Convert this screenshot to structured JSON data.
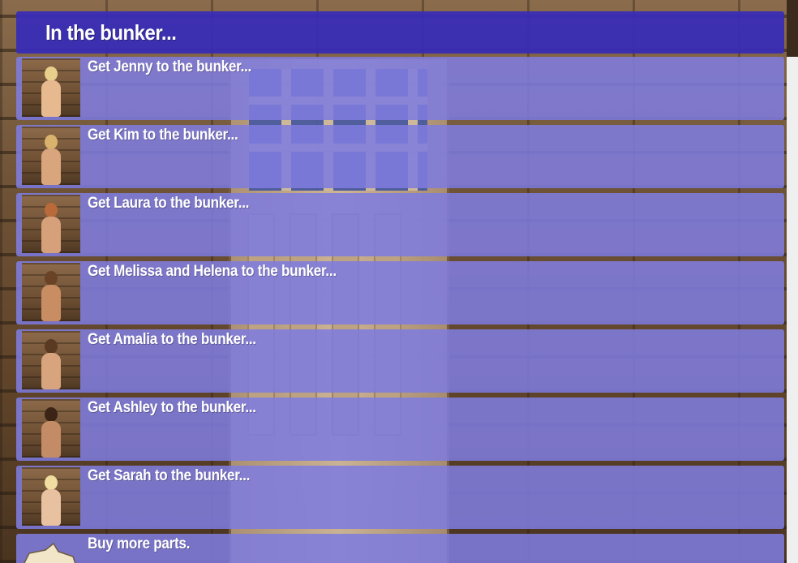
{
  "header": {
    "title": "In the bunker..."
  },
  "items": [
    {
      "label": "Get Jenny to the bunker...",
      "thumb": "jenny-portrait",
      "hair": "#e8cf8c",
      "skin": "#e6b98f"
    },
    {
      "label": "Get Kim to the bunker...",
      "thumb": "kim-portrait",
      "hair": "#d9b36e",
      "skin": "#d8a57c"
    },
    {
      "label": "Get Laura to the bunker...",
      "thumb": "laura-portrait",
      "hair": "#b96a3a",
      "skin": "#d6a07a"
    },
    {
      "label": "Get Melissa and Helena to the bunker...",
      "thumb": "melissa-helena-portrait",
      "hair": "#6a4326",
      "skin": "#c98d64"
    },
    {
      "label": "Get Amalia to the bunker...",
      "thumb": "amalia-portrait",
      "hair": "#5a3a22",
      "skin": "#d7a47d"
    },
    {
      "label": "Get Ashley to the bunker...",
      "thumb": "ashley-portrait",
      "hair": "#3b2416",
      "skin": "#c48c66"
    },
    {
      "label": "Get Sarah to the bunker...",
      "thumb": "sarah-portrait",
      "hair": "#f0dea0",
      "skin": "#e8c2a0"
    }
  ],
  "buy": {
    "label": "Buy more parts.",
    "icon": "parts-icon"
  },
  "colors": {
    "header_bg": "#3a2db8",
    "item_bg": "#807cde",
    "text": "#ffffff"
  }
}
